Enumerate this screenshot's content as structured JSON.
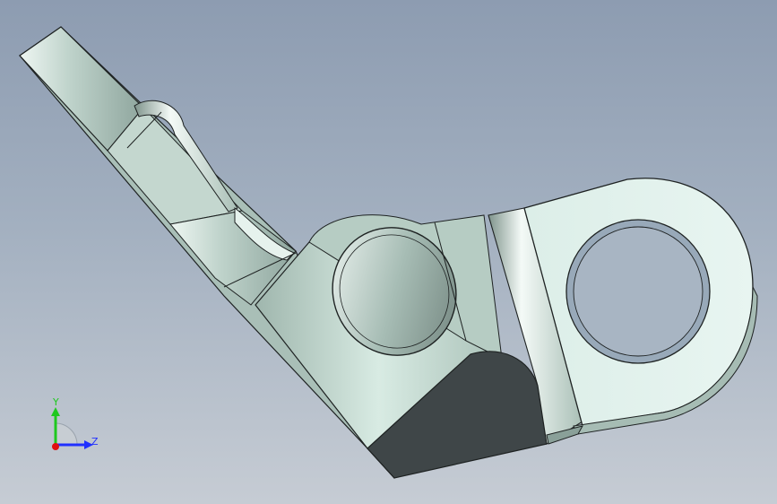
{
  "viewport": {
    "background_top": "#8d9cb1",
    "background_bottom": "#c6ccd4"
  },
  "model": {
    "name": "bent-bracket-part",
    "face_light": "#d2e6de",
    "face_mid": "#9fb5ad",
    "face_dark": "#3f4648",
    "edge_color": "#1e2222"
  },
  "triad": {
    "y_label": "Y",
    "z_label": "Z",
    "y_color": "#1ec81e",
    "z_color": "#2030ff",
    "x_color": "#e01010"
  }
}
